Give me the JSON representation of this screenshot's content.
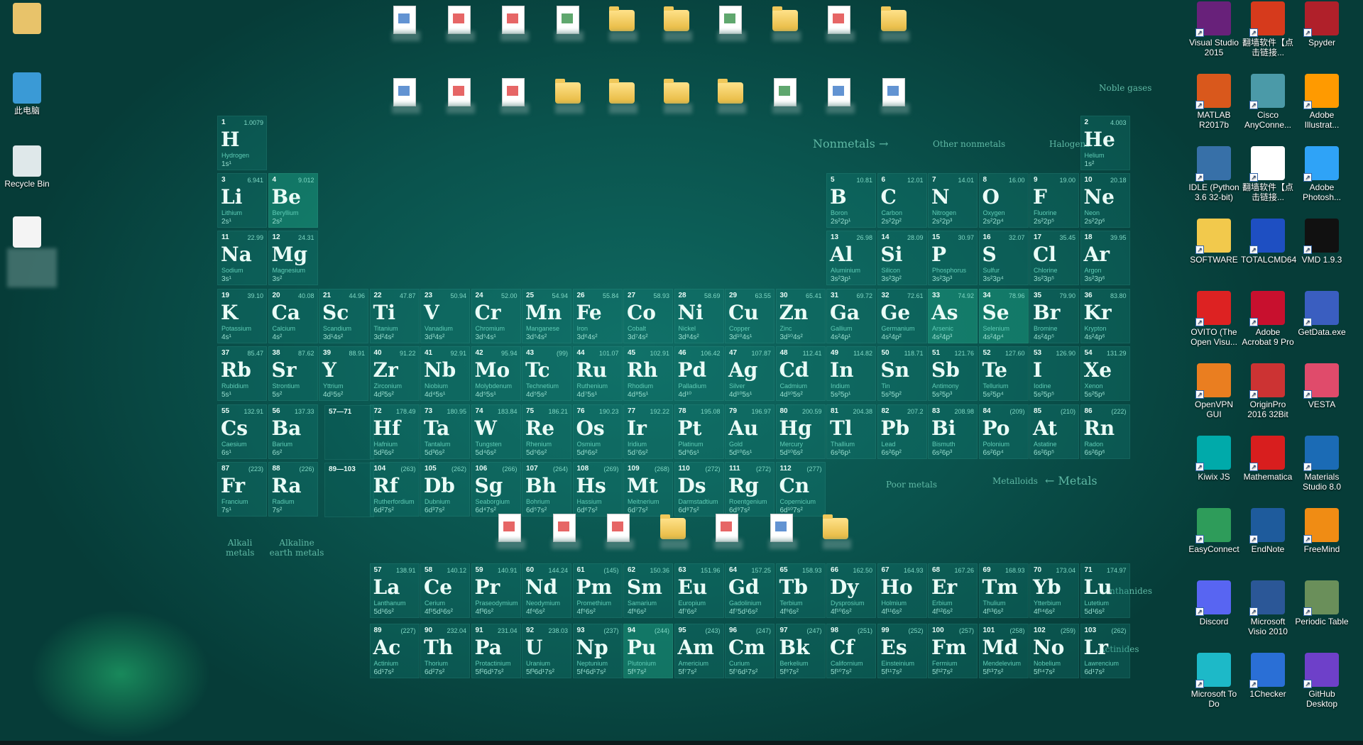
{
  "colors": {
    "accent": "#2fd6b0",
    "cell": "#147f74",
    "text": "#eafcf7"
  },
  "left_icons": [
    {
      "label": "",
      "icon": "user-folder-icon"
    },
    {
      "label": "此电脑",
      "icon": "computer-icon"
    },
    {
      "label": "Recycle Bin",
      "icon": "recycle-bin-icon"
    },
    {
      "label": "",
      "icon": "pdf-document-icon"
    }
  ],
  "right_icons": [
    {
      "label": "Visual Studio 2015",
      "icon": "visual-studio-icon",
      "color": "#68217a"
    },
    {
      "label": "翻墙软件【点击链接...",
      "icon": "psiphon-icon",
      "color": "#d63a1c"
    },
    {
      "label": "Spyder",
      "icon": "spyder-icon",
      "color": "#b0202a"
    },
    {
      "label": "MATLAB R2017b",
      "icon": "matlab-icon",
      "color": "#d9581c"
    },
    {
      "label": "Cisco AnyConne...",
      "icon": "cisco-anyconnect-icon",
      "color": "#4b9aa8"
    },
    {
      "label": "Adobe Illustrat...",
      "icon": "illustrator-icon",
      "color": "#ff9a00"
    },
    {
      "label": "IDLE (Python 3.6 32-bit)",
      "icon": "python-idle-icon",
      "color": "#3770a8"
    },
    {
      "label": "翻墙软件【点击链接...",
      "icon": "text-file-icon",
      "color": "#ffffff"
    },
    {
      "label": "Adobe Photosh...",
      "icon": "photoshop-icon",
      "color": "#2fa3f7"
    },
    {
      "label": "SOFTWARE",
      "icon": "folder-icon",
      "color": "#f2c94c"
    },
    {
      "label": "TOTALCMD64",
      "icon": "total-commander-icon",
      "color": "#1e4fc2"
    },
    {
      "label": "VMD 1.9.3",
      "icon": "vmd-icon",
      "color": "#111111"
    },
    {
      "label": "OVITO (The Open Visu...",
      "icon": "ovito-icon",
      "color": "#d22"
    },
    {
      "label": "Adobe Acrobat 9 Pro",
      "icon": "acrobat-icon",
      "color": "#c8102e"
    },
    {
      "label": "GetData.exe",
      "icon": "getdata-icon",
      "color": "#3a5ec0"
    },
    {
      "label": "OpenVPN GUI",
      "icon": "openvpn-icon",
      "color": "#ea7e20"
    },
    {
      "label": "OriginPro 2016 32Bit",
      "icon": "originpro-icon",
      "color": "#c33"
    },
    {
      "label": "VESTA",
      "icon": "vesta-icon",
      "color": "#e04b6b"
    },
    {
      "label": "Kiwix JS",
      "icon": "kiwix-icon",
      "color": "#0aa"
    },
    {
      "label": "Mathematica",
      "icon": "mathematica-icon",
      "color": "#d81e1e"
    },
    {
      "label": "Materials Studio 8.0",
      "icon": "materials-studio-icon",
      "color": "#1b6bb5"
    },
    {
      "label": "EasyConnect",
      "icon": "easyconnect-icon",
      "color": "#2e9c5a"
    },
    {
      "label": "EndNote",
      "icon": "endnote-icon",
      "color": "#1e5b9c"
    },
    {
      "label": "FreeMind",
      "icon": "freemind-icon",
      "color": "#f08c14"
    },
    {
      "label": "Discord",
      "icon": "discord-icon",
      "color": "#5865f2"
    },
    {
      "label": "Microsoft Visio 2010",
      "icon": "visio-icon",
      "color": "#2b5797"
    },
    {
      "label": "Periodic Table",
      "icon": "periodic-table-icon",
      "color": "#6a8f5a"
    },
    {
      "label": "Microsoft To Do",
      "icon": "todo-icon",
      "color": "#1db9c8"
    },
    {
      "label": "1Checker",
      "icon": "onechecker-icon",
      "color": "#2a6fd6"
    },
    {
      "label": "GitHub Desktop",
      "icon": "github-desktop-icon",
      "color": "#6e40c9"
    }
  ],
  "labels": {
    "noble_gases": "Noble gases",
    "nonmetals": "Nonmetals →",
    "other_nonmetals": "Other nonmetals",
    "halogens": "Halogens",
    "metals": "← Metals",
    "metalloids": "Metalloids",
    "poor_metals": "Poor metals",
    "alkali": "Alkali metals",
    "alkaline": "Alkaline earth metals",
    "lanthanides": "Lanthanides",
    "actinides": "Actinides",
    "la_placeholder": "57—71",
    "ac_placeholder": "89—103"
  },
  "elements": [
    [
      "1",
      "H",
      "Hydrogen",
      "1.0079",
      "1s¹",
      1,
      1
    ],
    [
      "2",
      "He",
      "Helium",
      "4.003",
      "1s²",
      1,
      18
    ],
    [
      "3",
      "Li",
      "Lithium",
      "6.941",
      "2s¹",
      2,
      1
    ],
    [
      "4",
      "Be",
      "Beryllium",
      "9.012",
      "2s²",
      2,
      2
    ],
    [
      "5",
      "B",
      "Boron",
      "10.81",
      "2s²2p¹",
      2,
      13
    ],
    [
      "6",
      "C",
      "Carbon",
      "12.01",
      "2s²2p²",
      2,
      14
    ],
    [
      "7",
      "N",
      "Nitrogen",
      "14.01",
      "2s²2p³",
      2,
      15
    ],
    [
      "8",
      "O",
      "Oxygen",
      "16.00",
      "2s²2p⁴",
      2,
      16
    ],
    [
      "9",
      "F",
      "Fluorine",
      "19.00",
      "2s²2p⁵",
      2,
      17
    ],
    [
      "10",
      "Ne",
      "Neon",
      "20.18",
      "2s²2p⁶",
      2,
      18
    ],
    [
      "11",
      "Na",
      "Sodium",
      "22.99",
      "3s¹",
      3,
      1
    ],
    [
      "12",
      "Mg",
      "Magnesium",
      "24.31",
      "3s²",
      3,
      2
    ],
    [
      "13",
      "Al",
      "Aluminium",
      "26.98",
      "3s²3p¹",
      3,
      13
    ],
    [
      "14",
      "Si",
      "Silicon",
      "28.09",
      "3s²3p²",
      3,
      14
    ],
    [
      "15",
      "P",
      "Phosphorus",
      "30.97",
      "3s²3p³",
      3,
      15
    ],
    [
      "16",
      "S",
      "Sulfur",
      "32.07",
      "3s²3p⁴",
      3,
      16
    ],
    [
      "17",
      "Cl",
      "Chlorine",
      "35.45",
      "3s²3p⁵",
      3,
      17
    ],
    [
      "18",
      "Ar",
      "Argon",
      "39.95",
      "3s²3p⁶",
      3,
      18
    ],
    [
      "19",
      "K",
      "Potassium",
      "39.10",
      "4s¹",
      4,
      1
    ],
    [
      "20",
      "Ca",
      "Calcium",
      "40.08",
      "4s²",
      4,
      2
    ],
    [
      "21",
      "Sc",
      "Scandium",
      "44.96",
      "3d¹4s²",
      4,
      3
    ],
    [
      "22",
      "Ti",
      "Titanium",
      "47.87",
      "3d²4s²",
      4,
      4
    ],
    [
      "23",
      "V",
      "Vanadium",
      "50.94",
      "3d³4s²",
      4,
      5
    ],
    [
      "24",
      "Cr",
      "Chromium",
      "52.00",
      "3d⁵4s¹",
      4,
      6
    ],
    [
      "25",
      "Mn",
      "Manganese",
      "54.94",
      "3d⁵4s²",
      4,
      7
    ],
    [
      "26",
      "Fe",
      "Iron",
      "55.84",
      "3d⁶4s²",
      4,
      8
    ],
    [
      "27",
      "Co",
      "Cobalt",
      "58.93",
      "3d⁷4s²",
      4,
      9
    ],
    [
      "28",
      "Ni",
      "Nickel",
      "58.69",
      "3d⁸4s²",
      4,
      10
    ],
    [
      "29",
      "Cu",
      "Copper",
      "63.55",
      "3d¹⁰4s¹",
      4,
      11
    ],
    [
      "30",
      "Zn",
      "Zinc",
      "65.41",
      "3d¹⁰4s²",
      4,
      12
    ],
    [
      "31",
      "Ga",
      "Gallium",
      "69.72",
      "4s²4p¹",
      4,
      13
    ],
    [
      "32",
      "Ge",
      "Germanium",
      "72.61",
      "4s²4p²",
      4,
      14
    ],
    [
      "33",
      "As",
      "Arsenic",
      "74.92",
      "4s²4p³",
      4,
      15
    ],
    [
      "34",
      "Se",
      "Selenium",
      "78.96",
      "4s²4p⁴",
      4,
      16
    ],
    [
      "35",
      "Br",
      "Bromine",
      "79.90",
      "4s²4p⁵",
      4,
      17
    ],
    [
      "36",
      "Kr",
      "Krypton",
      "83.80",
      "4s²4p⁶",
      4,
      18
    ],
    [
      "37",
      "Rb",
      "Rubidium",
      "85.47",
      "5s¹",
      5,
      1
    ],
    [
      "38",
      "Sr",
      "Strontium",
      "87.62",
      "5s²",
      5,
      2
    ],
    [
      "39",
      "Y",
      "Yttrium",
      "88.91",
      "4d¹5s²",
      5,
      3
    ],
    [
      "40",
      "Zr",
      "Zirconium",
      "91.22",
      "4d²5s²",
      5,
      4
    ],
    [
      "41",
      "Nb",
      "Niobium",
      "92.91",
      "4d⁴5s¹",
      5,
      5
    ],
    [
      "42",
      "Mo",
      "Molybdenum",
      "95.94",
      "4d⁵5s¹",
      5,
      6
    ],
    [
      "43",
      "Tc",
      "Technetium",
      "(99)",
      "4d⁵5s²",
      5,
      7
    ],
    [
      "44",
      "Ru",
      "Ruthenium",
      "101.07",
      "4d⁷5s¹",
      5,
      8
    ],
    [
      "45",
      "Rh",
      "Rhodium",
      "102.91",
      "4d⁸5s¹",
      5,
      9
    ],
    [
      "46",
      "Pd",
      "Palladium",
      "106.42",
      "4d¹⁰",
      5,
      10
    ],
    [
      "47",
      "Ag",
      "Silver",
      "107.87",
      "4d¹⁰5s¹",
      5,
      11
    ],
    [
      "48",
      "Cd",
      "Cadmium",
      "112.41",
      "4d¹⁰5s²",
      5,
      12
    ],
    [
      "49",
      "In",
      "Indium",
      "114.82",
      "5s²5p¹",
      5,
      13
    ],
    [
      "50",
      "Sn",
      "Tin",
      "118.71",
      "5s²5p²",
      5,
      14
    ],
    [
      "51",
      "Sb",
      "Antimony",
      "121.76",
      "5s²5p³",
      5,
      15
    ],
    [
      "52",
      "Te",
      "Tellurium",
      "127.60",
      "5s²5p⁴",
      5,
      16
    ],
    [
      "53",
      "I",
      "Iodine",
      "126.90",
      "5s²5p⁵",
      5,
      17
    ],
    [
      "54",
      "Xe",
      "Xenon",
      "131.29",
      "5s²5p⁶",
      5,
      18
    ],
    [
      "55",
      "Cs",
      "Caesium",
      "132.91",
      "6s¹",
      6,
      1
    ],
    [
      "56",
      "Ba",
      "Barium",
      "137.33",
      "6s²",
      6,
      2
    ],
    [
      "72",
      "Hf",
      "Hafnium",
      "178.49",
      "5d²6s²",
      6,
      4
    ],
    [
      "73",
      "Ta",
      "Tantalum",
      "180.95",
      "5d³6s²",
      6,
      5
    ],
    [
      "74",
      "W",
      "Tungsten",
      "183.84",
      "5d⁴6s²",
      6,
      6
    ],
    [
      "75",
      "Re",
      "Rhenium",
      "186.21",
      "5d⁵6s²",
      6,
      7
    ],
    [
      "76",
      "Os",
      "Osmium",
      "190.23",
      "5d⁶6s²",
      6,
      8
    ],
    [
      "77",
      "Ir",
      "Iridium",
      "192.22",
      "5d⁷6s²",
      6,
      9
    ],
    [
      "78",
      "Pt",
      "Platinum",
      "195.08",
      "5d⁹6s¹",
      6,
      10
    ],
    [
      "79",
      "Au",
      "Gold",
      "196.97",
      "5d¹⁰6s¹",
      6,
      11
    ],
    [
      "80",
      "Hg",
      "Mercury",
      "200.59",
      "5d¹⁰6s²",
      6,
      12
    ],
    [
      "81",
      "Tl",
      "Thallium",
      "204.38",
      "6s²6p¹",
      6,
      13
    ],
    [
      "82",
      "Pb",
      "Lead",
      "207.2",
      "6s²6p²",
      6,
      14
    ],
    [
      "83",
      "Bi",
      "Bismuth",
      "208.98",
      "6s²6p³",
      6,
      15
    ],
    [
      "84",
      "Po",
      "Polonium",
      "(209)",
      "6s²6p⁴",
      6,
      16
    ],
    [
      "85",
      "At",
      "Astatine",
      "(210)",
      "6s²6p⁵",
      6,
      17
    ],
    [
      "86",
      "Rn",
      "Radon",
      "(222)",
      "6s²6p⁶",
      6,
      18
    ],
    [
      "87",
      "Fr",
      "Francium",
      "(223)",
      "7s¹",
      7,
      1
    ],
    [
      "88",
      "Ra",
      "Radium",
      "(226)",
      "7s²",
      7,
      2
    ],
    [
      "104",
      "Rf",
      "Rutherfordium",
      "(263)",
      "6d²7s²",
      7,
      4
    ],
    [
      "105",
      "Db",
      "Dubnium",
      "(262)",
      "6d³7s²",
      7,
      5
    ],
    [
      "106",
      "Sg",
      "Seaborgium",
      "(266)",
      "6d⁴7s²",
      7,
      6
    ],
    [
      "107",
      "Bh",
      "Bohrium",
      "(264)",
      "6d⁵7s²",
      7,
      7
    ],
    [
      "108",
      "Hs",
      "Hassium",
      "(269)",
      "6d⁶7s²",
      7,
      8
    ],
    [
      "109",
      "Mt",
      "Meitnerium",
      "(268)",
      "6d⁷7s²",
      7,
      9
    ],
    [
      "110",
      "Ds",
      "Darmstadtium",
      "(272)",
      "6d⁸7s²",
      7,
      10
    ],
    [
      "111",
      "Rg",
      "Roentgenium",
      "(272)",
      "6d⁹7s²",
      7,
      11
    ],
    [
      "112",
      "Cn",
      "Copernicium",
      "(277)",
      "6d¹⁰7s²",
      7,
      12
    ],
    [
      "57",
      "La",
      "Lanthanum",
      "138.91",
      "5d¹6s²",
      9,
      4
    ],
    [
      "58",
      "Ce",
      "Cerium",
      "140.12",
      "4f¹5d¹6s²",
      9,
      5
    ],
    [
      "59",
      "Pr",
      "Praseodymium",
      "140.91",
      "4f³6s²",
      9,
      6
    ],
    [
      "60",
      "Nd",
      "Neodymium",
      "144.24",
      "4f⁴6s²",
      9,
      7
    ],
    [
      "61",
      "Pm",
      "Promethium",
      "(145)",
      "4f⁵6s²",
      9,
      8
    ],
    [
      "62",
      "Sm",
      "Samarium",
      "150.36",
      "4f⁶6s²",
      9,
      9
    ],
    [
      "63",
      "Eu",
      "Europium",
      "151.96",
      "4f⁷6s²",
      9,
      10
    ],
    [
      "64",
      "Gd",
      "Gadolinium",
      "157.25",
      "4f⁷5d¹6s²",
      9,
      11
    ],
    [
      "65",
      "Tb",
      "Terbium",
      "158.93",
      "4f⁹6s²",
      9,
      12
    ],
    [
      "66",
      "Dy",
      "Dysprosium",
      "162.50",
      "4f¹⁰6s²",
      9,
      13
    ],
    [
      "67",
      "Ho",
      "Holmium",
      "164.93",
      "4f¹¹6s²",
      9,
      14
    ],
    [
      "68",
      "Er",
      "Erbium",
      "167.26",
      "4f¹²6s²",
      9,
      15
    ],
    [
      "69",
      "Tm",
      "Thulium",
      "168.93",
      "4f¹³6s²",
      9,
      16
    ],
    [
      "70",
      "Yb",
      "Ytterbium",
      "173.04",
      "4f¹⁴6s²",
      9,
      17
    ],
    [
      "71",
      "Lu",
      "Lutetium",
      "174.97",
      "5d¹6s²",
      9,
      18
    ],
    [
      "89",
      "Ac",
      "Actinium",
      "(227)",
      "6d¹7s²",
      10,
      4
    ],
    [
      "90",
      "Th",
      "Thorium",
      "232.04",
      "6d²7s²",
      10,
      5
    ],
    [
      "91",
      "Pa",
      "Protactinium",
      "231.04",
      "5f²6d¹7s²",
      10,
      6
    ],
    [
      "92",
      "U",
      "Uranium",
      "238.03",
      "5f³6d¹7s²",
      10,
      7
    ],
    [
      "93",
      "Np",
      "Neptunium",
      "(237)",
      "5f⁴6d¹7s²",
      10,
      8
    ],
    [
      "94",
      "Pu",
      "Plutonium",
      "(244)",
      "5f⁶7s²",
      10,
      9
    ],
    [
      "95",
      "Am",
      "Americium",
      "(243)",
      "5f⁷7s²",
      10,
      10
    ],
    [
      "96",
      "Cm",
      "Curium",
      "(247)",
      "5f⁷6d¹7s²",
      10,
      11
    ],
    [
      "97",
      "Bk",
      "Berkelium",
      "(247)",
      "5f⁹7s²",
      10,
      12
    ],
    [
      "98",
      "Cf",
      "Californium",
      "(251)",
      "5f¹⁰7s²",
      10,
      13
    ],
    [
      "99",
      "Es",
      "Einsteinium",
      "(252)",
      "5f¹¹7s²",
      10,
      14
    ],
    [
      "100",
      "Fm",
      "Fermium",
      "(257)",
      "5f¹²7s²",
      10,
      15
    ],
    [
      "101",
      "Md",
      "Mendelevium",
      "(258)",
      "5f¹³7s²",
      10,
      16
    ],
    [
      "102",
      "No",
      "Nobelium",
      "(259)",
      "5f¹⁴7s²",
      10,
      17
    ],
    [
      "103",
      "Lr",
      "Lawrencium",
      "(262)",
      "6d¹7s²",
      10,
      18
    ]
  ],
  "highlighted": [
    "Be",
    "Se",
    "As",
    "Pu"
  ],
  "top_files_row1": [
    "shortcut-file-icon",
    "pdf-file-icon",
    "pdf-file-icon",
    "excel-file-icon",
    "folder-icon",
    "folder-icon",
    "excel-file-icon",
    "folder-icon",
    "document-file-icon",
    "folder-icon"
  ],
  "top_files_row2": [
    "media-file-icon",
    "pdf-file-icon",
    "pdf-file-icon",
    "folder-icon",
    "folder-icon",
    "folder-icon",
    "folder-icon",
    "excel-file-icon",
    "image-file-icon",
    "image-file-icon"
  ],
  "mid_files": [
    "archive-file-icon",
    "archive-file-icon",
    "winrar-file-icon",
    "folder-icon",
    "archive-file-icon",
    "image-file-icon",
    "folder-icon"
  ]
}
